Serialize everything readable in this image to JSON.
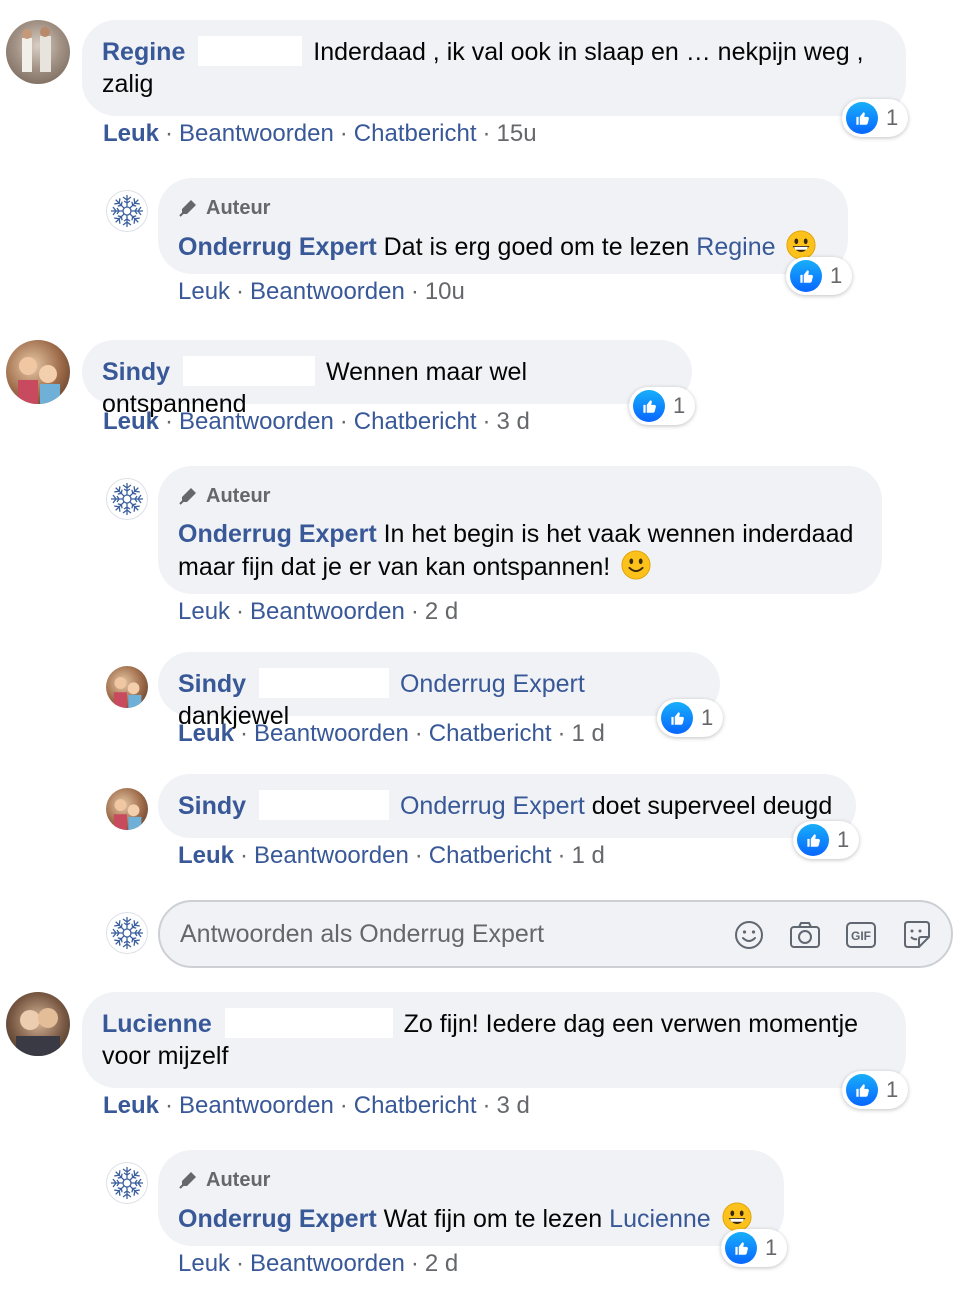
{
  "ui": {
    "author_label": "Auteur",
    "like": "Leuk",
    "reply": "Beantwoorden",
    "chat": "Chatbericht"
  },
  "comments": [
    {
      "name": "Regine",
      "text": "Inderdaad , ik val ook in slaap en … nekpijn weg , zalig",
      "time": "15u",
      "likes": "1",
      "reply": {
        "name": "Onderrug Expert",
        "text": "Dat is erg goed om te lezen",
        "mention": "Regine",
        "time": "10u",
        "likes": "1"
      }
    },
    {
      "name": "Sindy",
      "text": "Wennen maar wel ontspannend",
      "time": "3 d",
      "likes": "1",
      "reply": {
        "name": "Onderrug Expert",
        "text": "In het begin is het vaak wennen inderdaad maar fijn dat je er van kan ontspannen!",
        "time": "2 d"
      },
      "subreplies": [
        {
          "name": "Sindy",
          "mention": "Onderrug Expert",
          "text": "dankjewel",
          "time": "1 d",
          "likes": "1"
        },
        {
          "name": "Sindy",
          "mention": "Onderrug Expert",
          "text": "doet superveel deugd",
          "time": "1 d",
          "likes": "1"
        }
      ]
    },
    {
      "name": "Lucienne",
      "text": "Zo fijn! Iedere dag een verwen momentje voor mijzelf",
      "time": "3 d",
      "likes": "1",
      "reply": {
        "name": "Onderrug Expert",
        "text": "Wat fijn om te lezen",
        "mention": "Lucienne",
        "time": "2 d",
        "likes": "1"
      }
    }
  ],
  "reply_box": {
    "placeholder": "Antwoorden als Onderrug Expert",
    "icons": [
      "smiley-icon",
      "camera-icon",
      "gif-icon",
      "sticker-icon"
    ]
  },
  "colors": {
    "link": "#385898",
    "bubble": "#f0f2f5",
    "meta": "#65676b",
    "like_blue": "#0766ff"
  }
}
